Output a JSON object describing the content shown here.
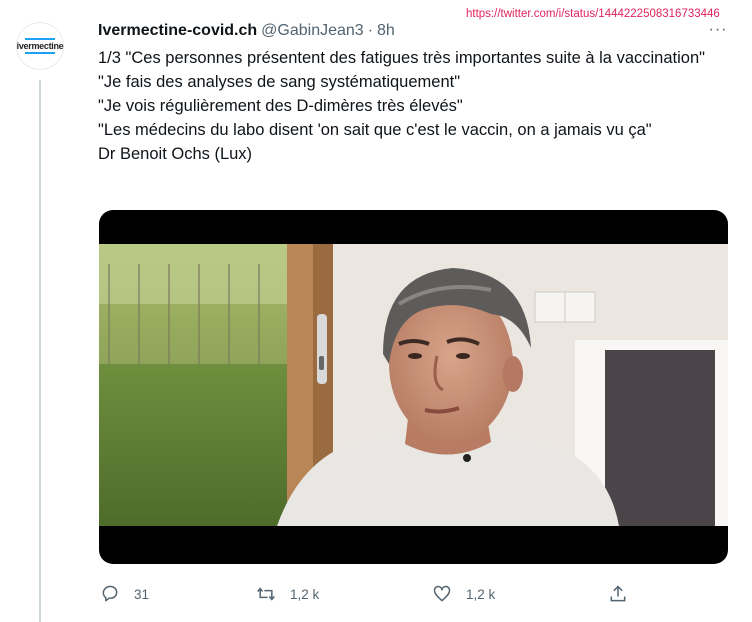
{
  "screenshot_url": "https://twitter.com/i/status/1444222508316733446",
  "tweet": {
    "author_name": "Ivermectine-covid.ch",
    "handle": "@GabinJean3",
    "separator": "·",
    "time": "8h",
    "avatar_text": "ivermectine",
    "text_lines": [
      "1/3 \"Ces personnes présentent des fatigues très importantes suite à la vaccination\"",
      "\"Je fais des analyses de sang systématiquement\"",
      "\"Je vois régulièrement des D-dimères très élevés\"",
      "\"Les médecins du labo disent 'on sait que c'est le vaccin, on a jamais vu ça\"",
      "Dr Benoit Ochs (Lux)"
    ]
  },
  "actions": {
    "reply_count": "31",
    "retweet_count": "1,2 k",
    "like_count": "1,2 k"
  },
  "icons": {
    "more": "more-horizontal-icon",
    "reply": "reply-icon",
    "retweet": "retweet-icon",
    "like": "heart-icon",
    "share": "share-icon"
  },
  "colors": {
    "text": "#0f1419",
    "secondary": "#536471",
    "url": "#e0245e",
    "accent": "#1da1f2"
  }
}
